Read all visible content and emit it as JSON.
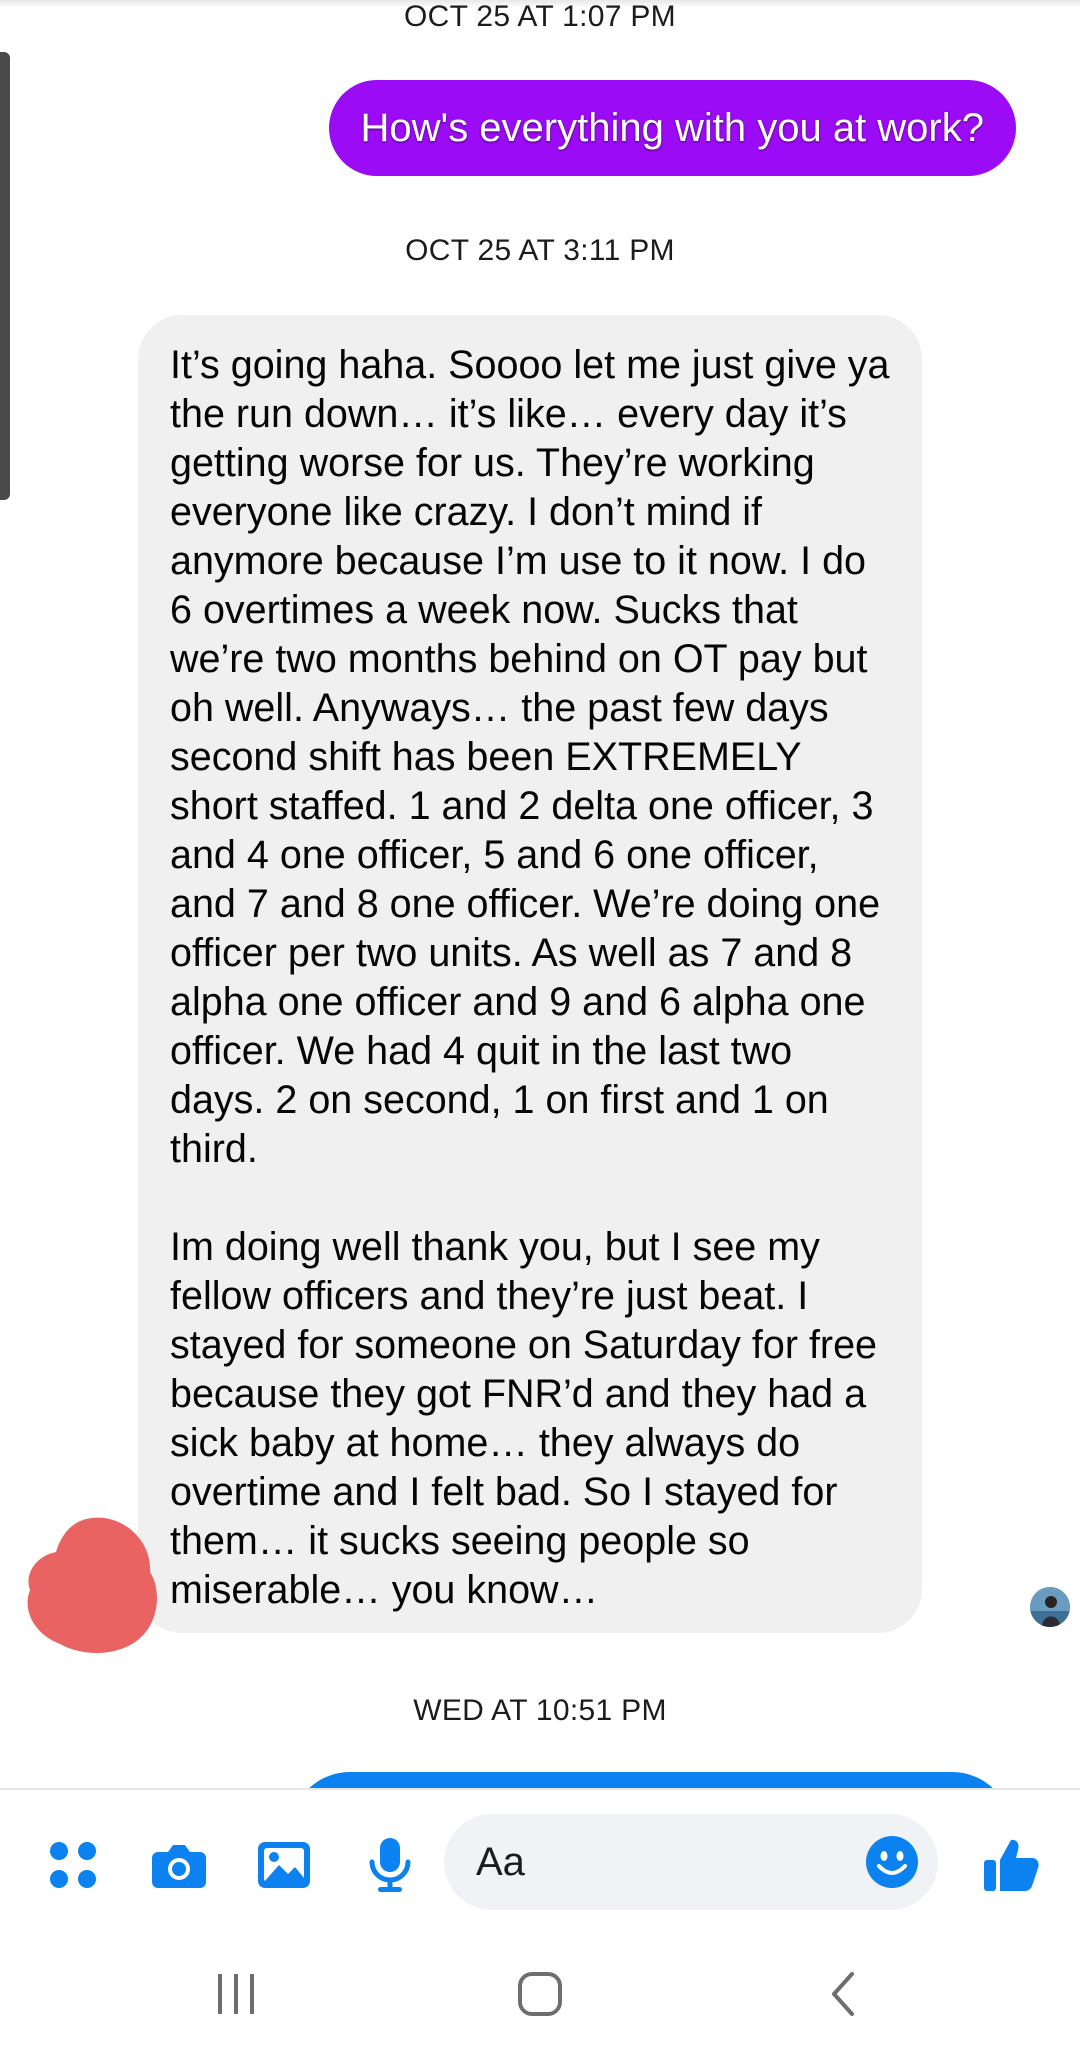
{
  "conversation": {
    "timestamps": {
      "first": "OCT 25 AT 1:07 PM",
      "second": "OCT 25 AT 3:11 PM",
      "third": "WED AT 10:51 PM"
    },
    "outgoing_message": "How's everything with you at work?",
    "incoming_message": {
      "paragraph_1": "It’s going haha. Soooo let me just give ya the run down… it’s like… every day it’s getting worse for us. They’re working everyone like crazy. I don’t mind if anymore because I’m use to it now. I do 6 overtimes a week now. Sucks that we’re two months behind on OT pay but oh well. Anyways… the past few days second shift has been EXTREMELY short staffed. 1 and 2 delta one officer, 3 and 4 one officer, 5 and 6 one officer, and 7 and 8 one officer. We’re doing one officer per two units. As well as 7 and 8 alpha one officer and 9 and 6 alpha one officer. We had 4 quit in the last two days. 2 on second, 1 on first and 1 on third.",
      "paragraph_2": "Im doing well thank you, but I see my fellow officers and they’re just beat. I stayed for someone on Saturday for free because they got FNR’d and they had a sick baby at home… they always do overtime and I felt bad. So I stayed for them… it sucks seeing people so miserable… you know…"
    }
  },
  "composer": {
    "placeholder": "Aa",
    "value": "",
    "icons": [
      "apps-icon",
      "camera-icon",
      "gallery-icon",
      "microphone-icon",
      "emoji-icon",
      "thumbs-up-icon"
    ]
  },
  "navigation": {
    "icons": [
      "recent-apps-icon",
      "home-icon",
      "back-icon"
    ]
  },
  "colors": {
    "outgoing_bubble": "#9b0bf5",
    "incoming_bubble": "#f0f0f0",
    "messenger_blue": "#0b82f0",
    "reaction_blob": "#e96363"
  }
}
